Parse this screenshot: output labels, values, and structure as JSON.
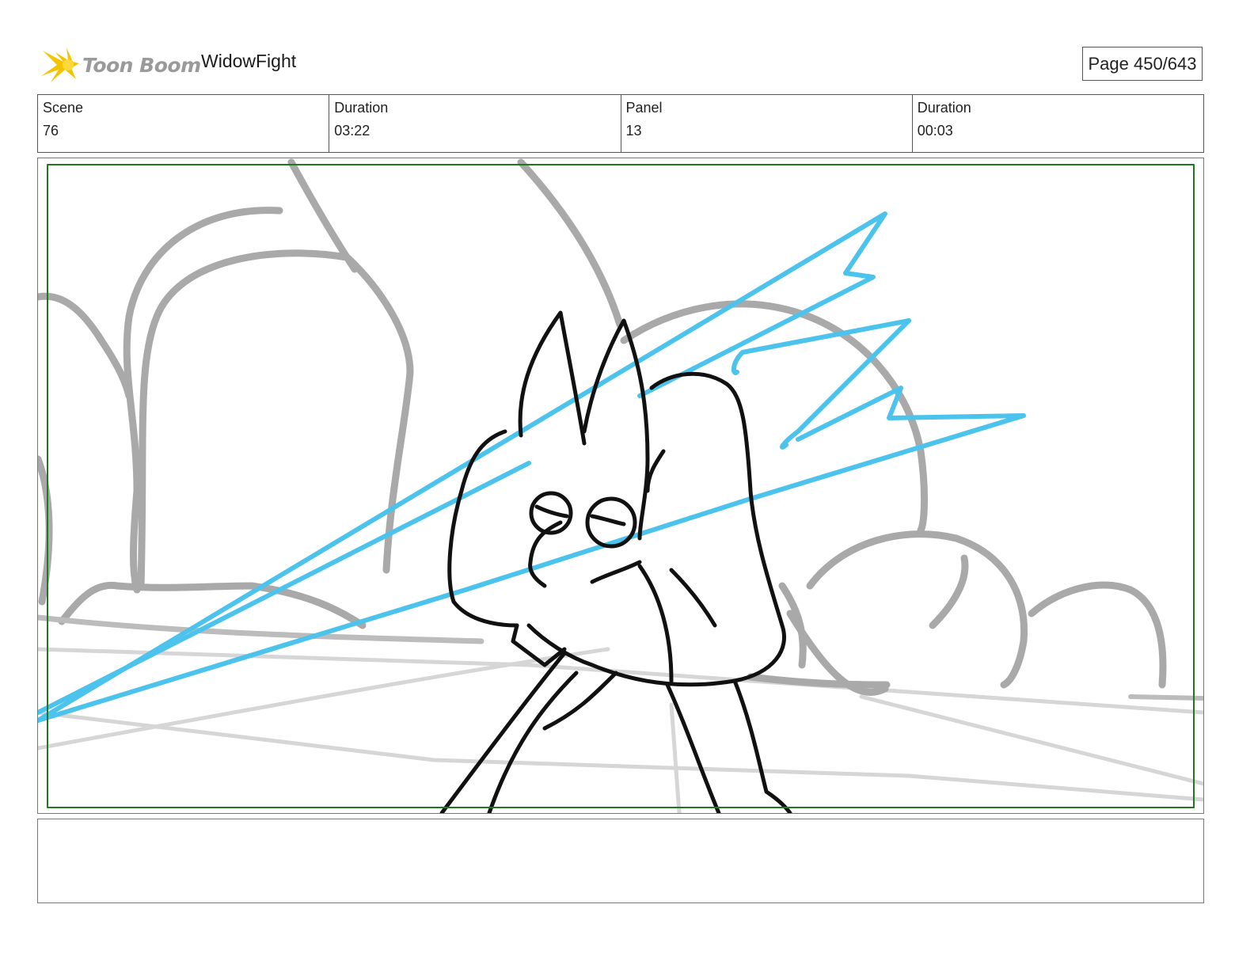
{
  "header": {
    "brand": "Toon Boom",
    "project": "WidowFight",
    "page": "Page 450/643"
  },
  "info": {
    "scene_label": "Scene",
    "scene_value": "76",
    "scene_duration_label": "Duration",
    "scene_duration_value": "03:22",
    "panel_label": "Panel",
    "panel_value": "13",
    "panel_duration_label": "Duration",
    "panel_duration_value": "00:03"
  },
  "notes": {
    "text": ""
  },
  "colors": {
    "safe_frame": "#1f7a1f",
    "lightning": "#4cc3ec",
    "sketch_gray": "#a8a8a8",
    "ink": "#111111",
    "logo_yellow": "#f5c400"
  }
}
